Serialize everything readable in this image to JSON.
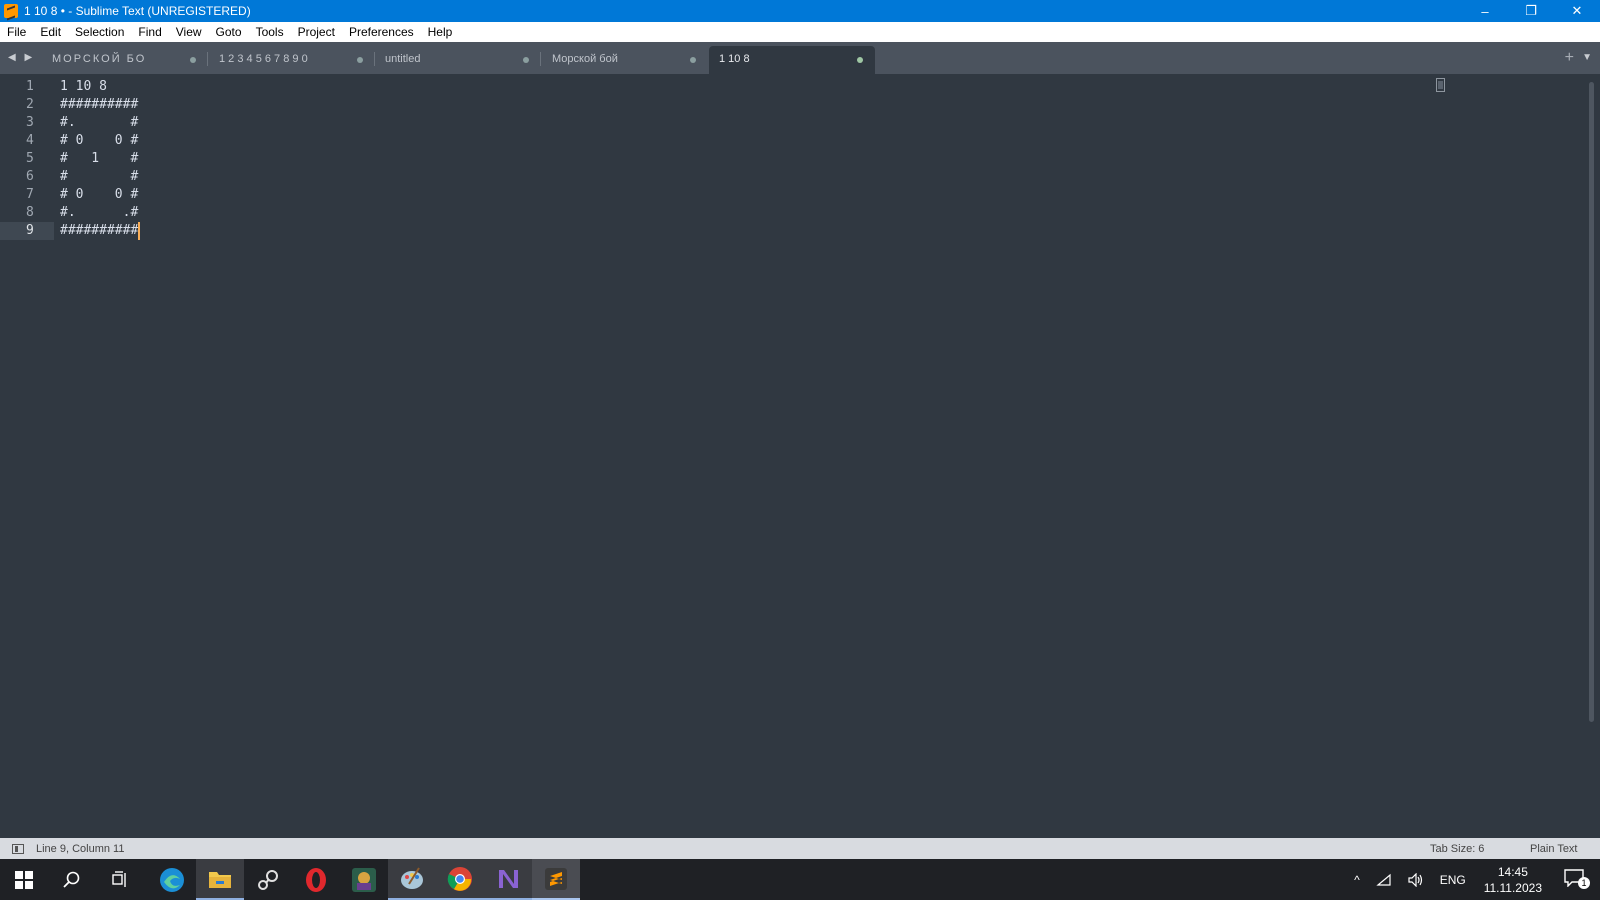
{
  "window": {
    "title": "1 10 8 • - Sublime Text (UNREGISTERED)",
    "minimize": "–",
    "restore": "❐",
    "close": "✕"
  },
  "menu": [
    "File",
    "Edit",
    "Selection",
    "Find",
    "View",
    "Goto",
    "Tools",
    "Project",
    "Preferences",
    "Help"
  ],
  "tabs": [
    {
      "label": "МОРСКОЙ БО",
      "dirty": true,
      "active": false
    },
    {
      "label": "1 2 3 4 5 6 7 8 9 0",
      "dirty": true,
      "active": false
    },
    {
      "label": "untitled",
      "dirty": true,
      "active": false
    },
    {
      "label": "Морской бой",
      "dirty": true,
      "active": false
    },
    {
      "label": "1 10 8",
      "dirty": true,
      "active": true
    }
  ],
  "tabbar_icons": {
    "nav": "◀ ▶",
    "plus": "+",
    "menu": "▼"
  },
  "editor": {
    "lines": [
      "1 10 8",
      "##########",
      "#.       #",
      "# 0    0 #",
      "#   1    #",
      "#        #",
      "# 0    0 #",
      "#.      .#",
      "##########"
    ],
    "current_line": 9
  },
  "status": {
    "position": "Line 9, Column 11",
    "tab_size": "Tab Size: 6",
    "syntax": "Plain Text"
  },
  "taskbar": {
    "apps": [
      {
        "name": "start-icon",
        "color": "#ffffff"
      },
      {
        "name": "search-icon",
        "color": "#ffffff"
      },
      {
        "name": "task-view-icon",
        "color": "#ffffff"
      },
      {
        "name": "edge-icon",
        "color": "#2ea3e0"
      },
      {
        "name": "file-explorer-icon",
        "color": "#f2c94c"
      },
      {
        "name": "steam-icon",
        "color": "#e0e0e0"
      },
      {
        "name": "opera-icon",
        "color": "#e0282d"
      },
      {
        "name": "game-icon",
        "color": "#3f8f6e"
      },
      {
        "name": "paint-icon",
        "color": "#7ab8e0"
      },
      {
        "name": "chrome-icon",
        "color": "#4caf50"
      },
      {
        "name": "visual-studio-icon",
        "color": "#8a63d2"
      },
      {
        "name": "sublime-icon",
        "color": "#ff9800"
      }
    ],
    "tray": {
      "chevron": "^",
      "language": "ENG",
      "time": "14:45",
      "date": "11.11.2023",
      "notifications": "1"
    }
  }
}
